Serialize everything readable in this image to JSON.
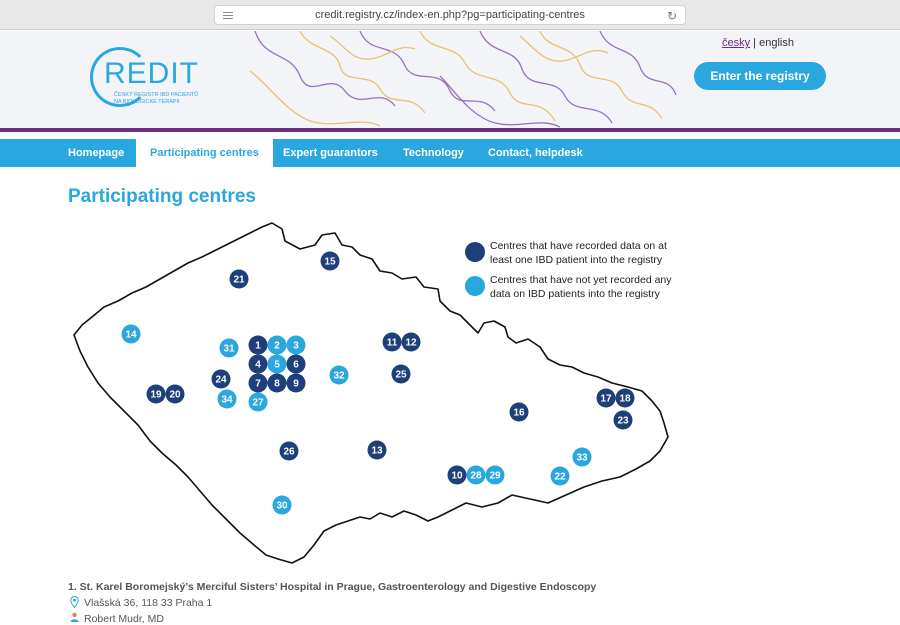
{
  "browser": {
    "url": "credit.registry.cz/index-en.php?pg=participating-centres"
  },
  "header": {
    "logo_text": "REDIT",
    "logo_sub_line1": "ČESKÝ REGISTR IBD PACIENTŮ",
    "logo_sub_line2": "NA BIOLOGICKÉ TERAPII",
    "lang_cz": "česky",
    "lang_sep": " | ",
    "lang_en": "english",
    "enter_label": "Enter the registry"
  },
  "colors": {
    "accent": "#2aa7df",
    "dark": "#1e3f7a",
    "light": "#2aa7df",
    "purple": "#6b2c84"
  },
  "nav": {
    "items": [
      {
        "label": "Homepage",
        "active": false
      },
      {
        "label": "Participating centres",
        "active": true
      },
      {
        "label": "Expert guarantors",
        "active": false
      },
      {
        "label": "Technology",
        "active": false
      },
      {
        "label": "Contact, helpdesk",
        "active": false
      }
    ]
  },
  "page": {
    "title": "Participating centres"
  },
  "legend": {
    "dark_line1": "Centres that have recorded data on at",
    "dark_line2": "least one IBD patient into the registry",
    "light_line1": "Centres that have not yet recorded any",
    "light_line2": "data on IBD patients into the registry"
  },
  "markers": [
    {
      "n": "1",
      "type": "dark"
    },
    {
      "n": "2",
      "type": "light"
    },
    {
      "n": "3",
      "type": "light"
    },
    {
      "n": "4",
      "type": "dark"
    },
    {
      "n": "5",
      "type": "light"
    },
    {
      "n": "6",
      "type": "dark"
    },
    {
      "n": "7",
      "type": "dark"
    },
    {
      "n": "8",
      "type": "dark"
    },
    {
      "n": "9",
      "type": "dark"
    },
    {
      "n": "10",
      "type": "dark"
    },
    {
      "n": "11",
      "type": "dark"
    },
    {
      "n": "12",
      "type": "dark"
    },
    {
      "n": "13",
      "type": "dark"
    },
    {
      "n": "14",
      "type": "light"
    },
    {
      "n": "15",
      "type": "dark"
    },
    {
      "n": "16",
      "type": "dark"
    },
    {
      "n": "17",
      "type": "dark"
    },
    {
      "n": "18",
      "type": "dark"
    },
    {
      "n": "19",
      "type": "dark"
    },
    {
      "n": "20",
      "type": "dark"
    },
    {
      "n": "21",
      "type": "dark"
    },
    {
      "n": "22",
      "type": "light"
    },
    {
      "n": "23",
      "type": "dark"
    },
    {
      "n": "24",
      "type": "dark"
    },
    {
      "n": "25",
      "type": "dark"
    },
    {
      "n": "26",
      "type": "dark"
    },
    {
      "n": "27",
      "type": "light"
    },
    {
      "n": "28",
      "type": "light"
    },
    {
      "n": "29",
      "type": "light"
    },
    {
      "n": "30",
      "type": "light"
    },
    {
      "n": "31",
      "type": "light"
    },
    {
      "n": "32",
      "type": "light"
    },
    {
      "n": "33",
      "type": "light"
    },
    {
      "n": "34",
      "type": "light"
    }
  ],
  "centre": {
    "title": "1. St. Karel Boromejský’s Merciful Sisters’ Hospital in Prague, Gastroenterology and Digestive Endoscopy",
    "address": "Vlašská 36, 118 33 Praha 1",
    "doctor": "Robert Mudr, MD"
  }
}
